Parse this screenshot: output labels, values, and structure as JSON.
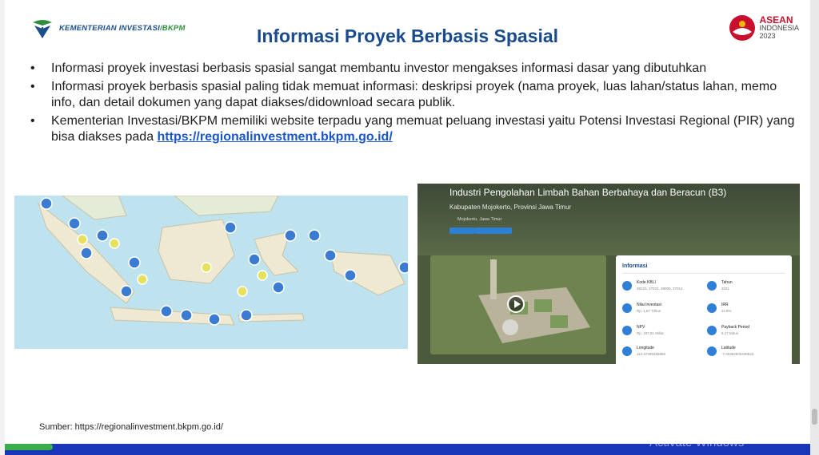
{
  "header": {
    "ministry_logo_text": "KEMENTERIAN INVESTASI",
    "ministry_logo_suffix": "/BKPM",
    "title": "Informasi Proyek Berbasis Spasial",
    "asean_logo": {
      "line1": "ASEAN",
      "line2": "INDONESIA",
      "line3": "2023"
    }
  },
  "bullets": [
    {
      "text": "Informasi proyek investasi berbasis spasial sangat membantu investor mengakses informasi dasar yang dibutuhkan"
    },
    {
      "text": "Informasi proyek berbasis spasial paling tidak memuat informasi: deskripsi proyek (nama proyek, luas lahan/status lahan, memo info, dan detail dokumen yang dapat diakses/didownload secara publik."
    },
    {
      "text": "Kementerian Investasi/BKPM memiliki website terpadu yang memuat peluang investasi yaitu Potensi Investasi Regional (PIR) yang bisa diakses pada ",
      "link": "https://regionalinvestment.bkpm.go.id/"
    }
  ],
  "bullet_symbol": "•",
  "project_screenshot": {
    "title": "Industri Pengolahan Limbah Bahan Berbahaya dan Beracun (B3)",
    "subtitle": "Kabupaten Mojokerto, Provinsi Jawa Timur",
    "location": "Mojokerto, Jawa Timur",
    "panel_heading": "Informasi",
    "info": [
      {
        "key": "Kode KBLI",
        "value": "38220, 37022, 39000, 37012"
      },
      {
        "key": "Tahun",
        "value": "2021"
      },
      {
        "key": "Nilai Investasi",
        "value": "Rp. 1,67 Triliun"
      },
      {
        "key": "IRR",
        "value": "11,8%"
      },
      {
        "key": "NPV",
        "value": "Rp. 187,81 Miliar"
      },
      {
        "key": "Payback Period",
        "value": "6,17 tahun"
      },
      {
        "key": "Longitude",
        "value": "112.37399266866"
      },
      {
        "key": "Latitude",
        "value": "-7.35362600428533"
      }
    ]
  },
  "source": "Sumber: https://regionalinvestment.bkpm.go.id/",
  "watermark": "Activate Windows",
  "colors": {
    "title": "#1a4b8c",
    "link": "#1a56c8",
    "footer": "#1a36b8",
    "accent_green": "#3aae4a"
  }
}
